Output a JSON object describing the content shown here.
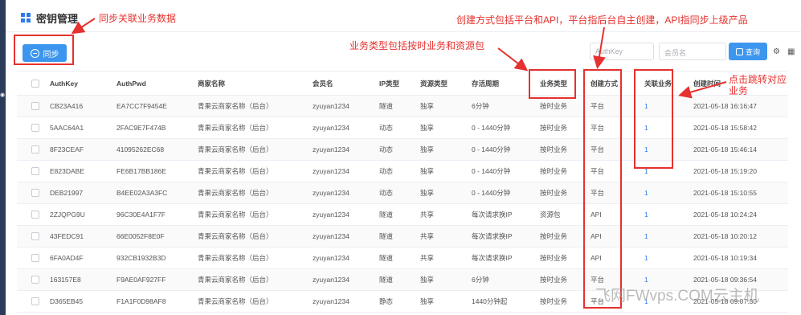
{
  "header": {
    "title": "密钥管理"
  },
  "toolbar": {
    "sync_label": "同步",
    "authkey_placeholder": "AuthKey",
    "member_placeholder": "会员名",
    "query_label": "查询"
  },
  "table": {
    "columns": [
      "AuthKey",
      "AuthPwd",
      "商家名称",
      "会员名",
      "IP类型",
      "资源类型",
      "存活周期",
      "业务类型",
      "创建方式",
      "关联业务",
      "创建时间"
    ],
    "rows": [
      [
        "CB23A416",
        "EA7CC7F9454E",
        "青果云商家名称（后台）",
        "zyuyan1234",
        "隧道",
        "独享",
        "6分钟",
        "按时业务",
        "平台",
        "1",
        "2021-05-18 16:16:47"
      ],
      [
        "5AAC64A1",
        "2FAC9E7F474B",
        "青果云商家名称（后台）",
        "zyuyan1234",
        "动态",
        "独享",
        "0 - 1440分钟",
        "按时业务",
        "平台",
        "1",
        "2021-05-18 15:58:42"
      ],
      [
        "8F23CEAF",
        "41095262EC68",
        "青果云商家名称（后台）",
        "zyuyan1234",
        "动态",
        "独享",
        "0 - 1440分钟",
        "按时业务",
        "平台",
        "1",
        "2021-05-18 15:46:14"
      ],
      [
        "E823DABE",
        "FE6B17BB186E",
        "青果云商家名称（后台）",
        "zyuyan1234",
        "动态",
        "独享",
        "0 - 1440分钟",
        "按时业务",
        "平台",
        "1",
        "2021-05-18 15:19:20"
      ],
      [
        "DEB21997",
        "B4EE02A3A3FC",
        "青果云商家名称（后台）",
        "zyuyan1234",
        "动态",
        "独享",
        "0 - 1440分钟",
        "按时业务",
        "平台",
        "1",
        "2021-05-18 15:10:55"
      ],
      [
        "2ZJQPG9U",
        "96C30E4A1F7F",
        "青果云商家名称（后台）",
        "zyuyan1234",
        "隧道",
        "共享",
        "每次请求换IP",
        "资源包",
        "API",
        "1",
        "2021-05-18 10:24:24"
      ],
      [
        "43FEDC91",
        "66E0052F8E0F",
        "青果云商家名称（后台）",
        "zyuyan1234",
        "隧道",
        "共享",
        "每次请求换IP",
        "按时业务",
        "API",
        "1",
        "2021-05-18 10:20:12"
      ],
      [
        "6FA0AD4F",
        "932CB1932B3D",
        "青果云商家名称（后台）",
        "zyuyan1234",
        "隧道",
        "共享",
        "每次请求换IP",
        "按时业务",
        "API",
        "1",
        "2021-05-18 10:19:34"
      ],
      [
        "163157E8",
        "F9AE0AF927FF",
        "青果云商家名称（后台）",
        "zyuyan1234",
        "隧道",
        "独享",
        "6分钟",
        "按时业务",
        "平台",
        "1",
        "2021-05-18 09:36:54"
      ],
      [
        "D365EB45",
        "F1A1F0D98AF8",
        "青果云商家名称（后台）",
        "zyuyan1234",
        "静态",
        "独享",
        "1440分钟起",
        "按时业务",
        "平台",
        "1",
        "2021-05-18 09:07:30"
      ]
    ]
  },
  "annotations": {
    "sync_note": "同步关联业务数据",
    "create_note": "创建方式包括平台和API，平台指后台自主创建，API指同步上级产品",
    "biztype_note": "业务类型包括按时业务和资源包",
    "link_note_line1": "点击跳转对应",
    "link_note_line2": "业务",
    "color": "#e6312e"
  },
  "watermark": "飞网FWvps.COM云主机",
  "colors": {
    "primary": "#3d96ee",
    "link": "#2f7be5",
    "sidebar": "#2a3c5a"
  }
}
